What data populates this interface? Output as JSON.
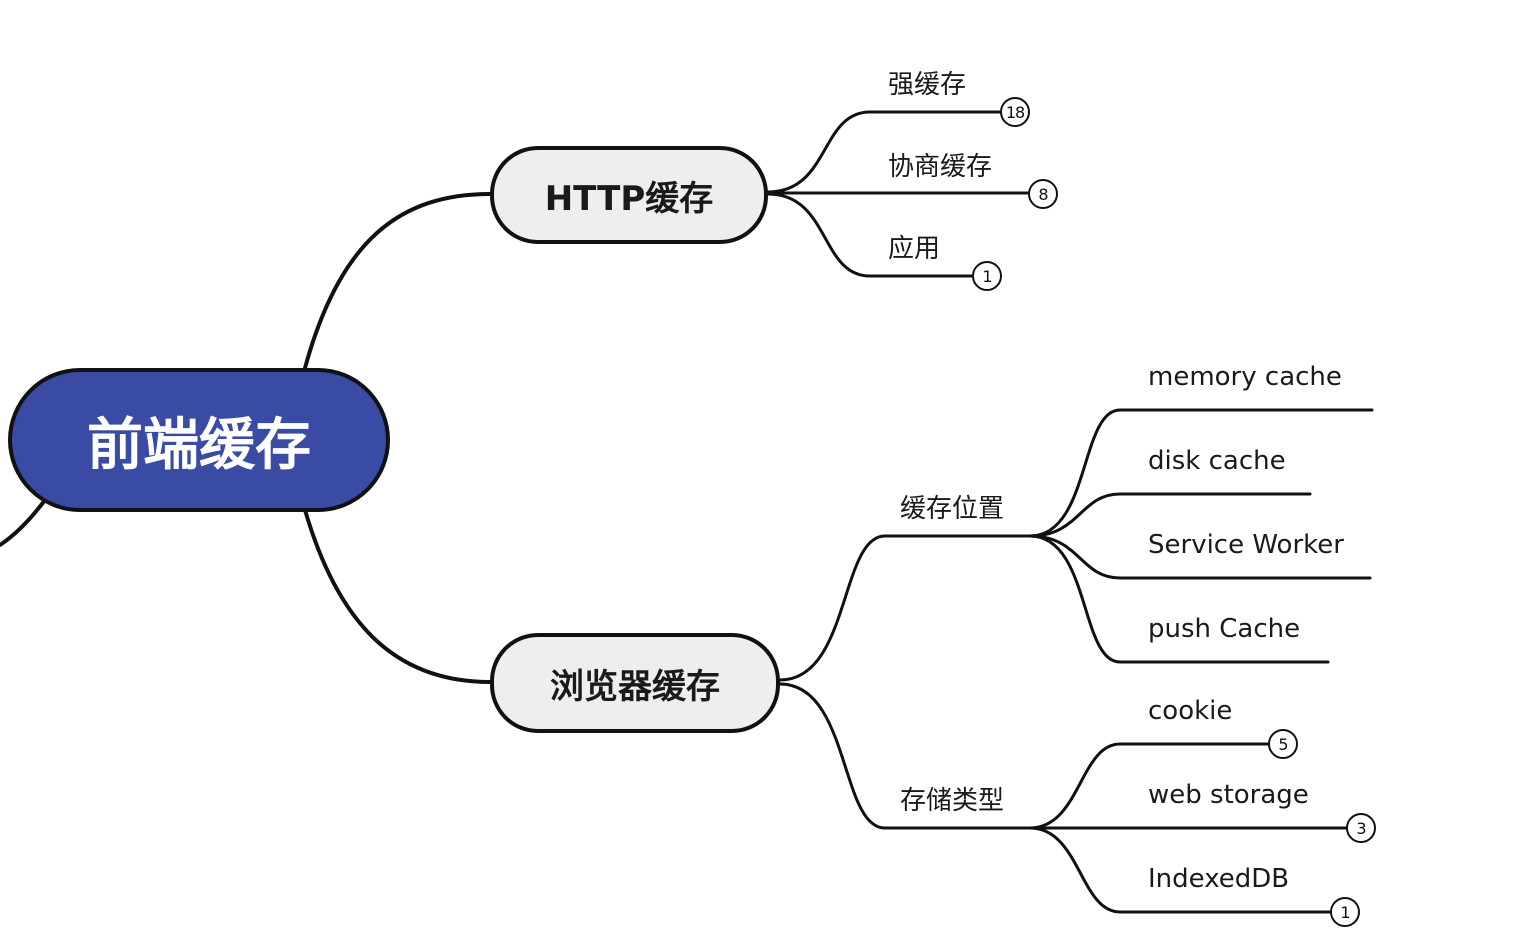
{
  "root": {
    "label": "前端缓存"
  },
  "branches": {
    "http": {
      "label": "HTTP缓存",
      "children": [
        {
          "label": "强缓存",
          "count": "18"
        },
        {
          "label": "协商缓存",
          "count": "8"
        },
        {
          "label": "应用",
          "count": "1"
        }
      ]
    },
    "browser": {
      "label": "浏览器缓存",
      "location": {
        "label": "缓存位置",
        "children": [
          {
            "label": "memory cache"
          },
          {
            "label": "disk cache"
          },
          {
            "label": "Service Worker"
          },
          {
            "label": "push Cache"
          }
        ]
      },
      "storage": {
        "label": "存储类型",
        "children": [
          {
            "label": "cookie",
            "count": "5"
          },
          {
            "label": "web storage",
            "count": "3"
          },
          {
            "label": "IndexedDB",
            "count": "1"
          }
        ]
      }
    }
  },
  "colors": {
    "root_fill": "#3a4ba3",
    "main_fill": "#eeeeee",
    "line": "#111111"
  }
}
